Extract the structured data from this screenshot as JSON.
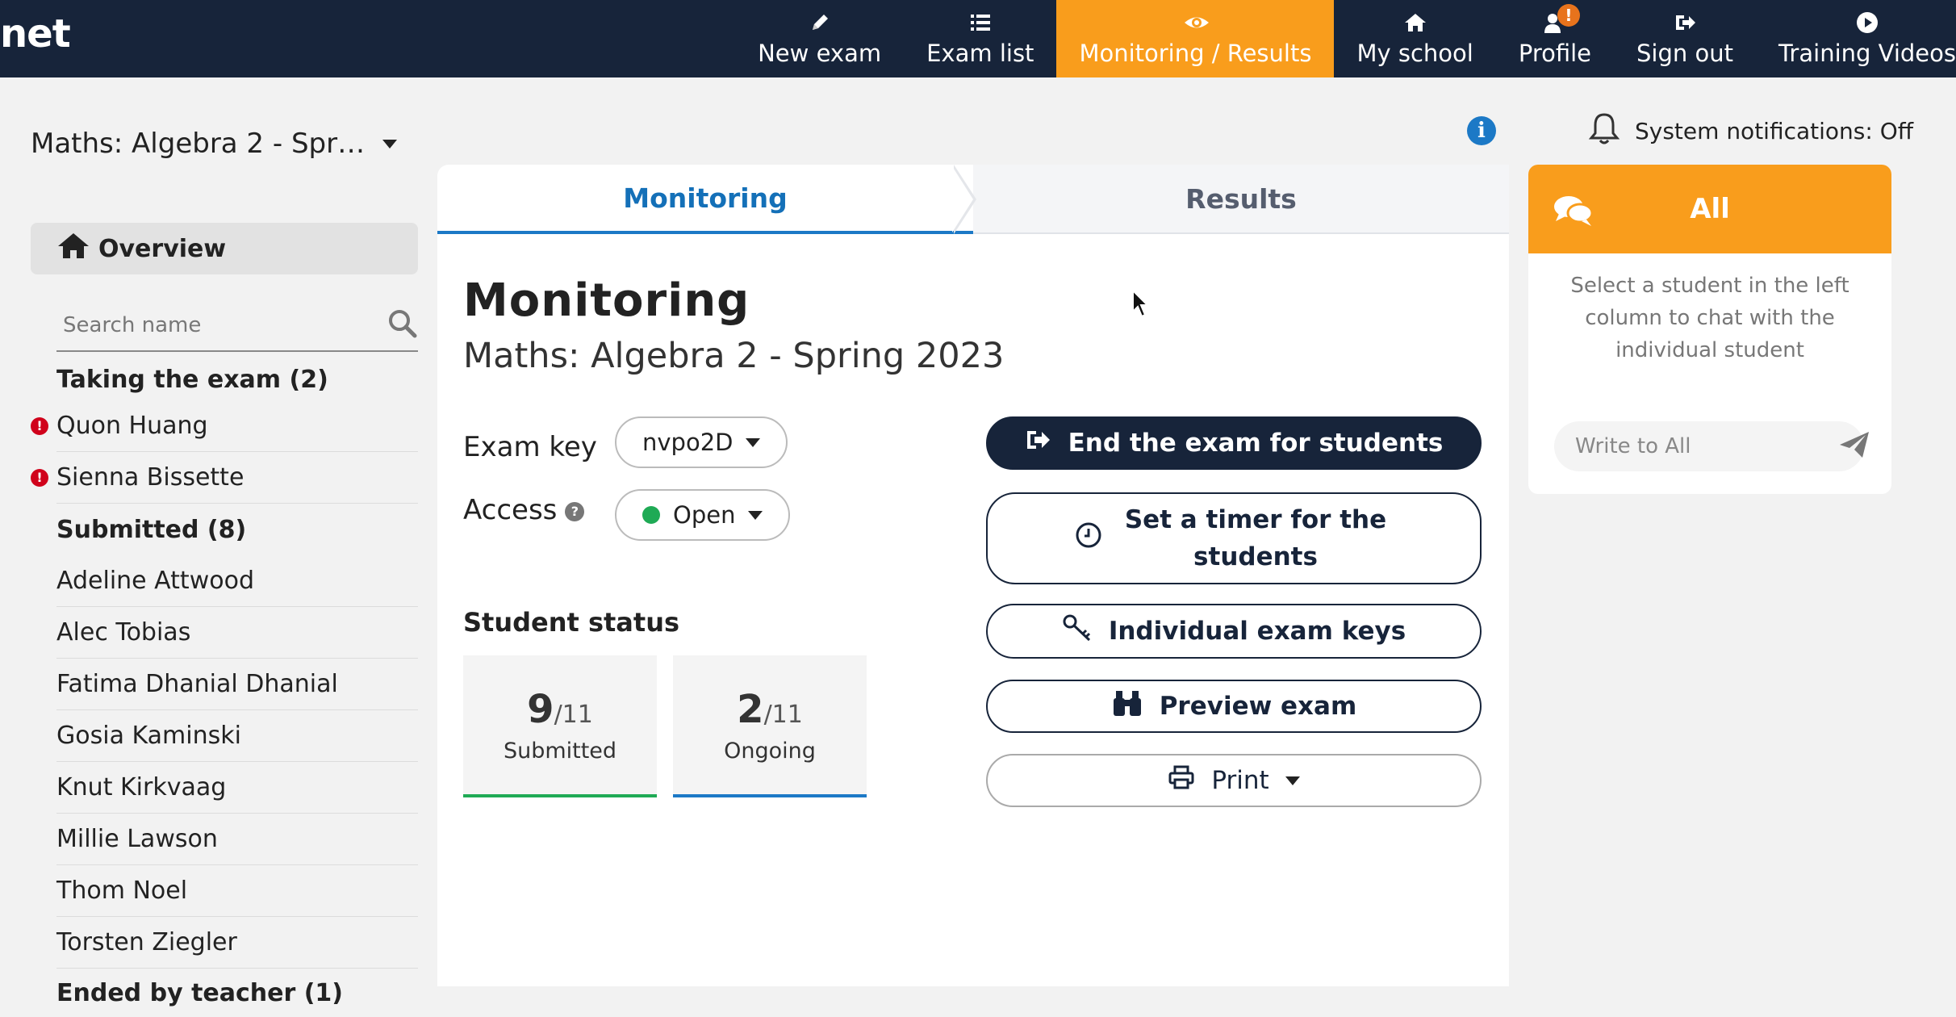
{
  "nav": {
    "brand": "net",
    "items": [
      {
        "label": "New exam",
        "icon": "pencil-icon"
      },
      {
        "label": "Exam list",
        "icon": "list-icon"
      },
      {
        "label": "Monitoring / Results",
        "icon": "eye-icon",
        "active": true
      },
      {
        "label": "My school",
        "icon": "home-icon"
      },
      {
        "label": "Profile",
        "icon": "users-icon",
        "badge": "!"
      },
      {
        "label": "Sign out",
        "icon": "sign-out-icon"
      },
      {
        "label": "Training Videos",
        "icon": "play-icon"
      }
    ]
  },
  "sidebar": {
    "exam_select": "Maths: Algebra 2 - Spr…",
    "overview_label": "Overview",
    "search_placeholder": "Search name",
    "groups": [
      {
        "title": "Taking the exam (2)",
        "students": [
          {
            "name": "Quon Huang",
            "warning": true
          },
          {
            "name": "Sienna Bissette",
            "warning": true
          }
        ]
      },
      {
        "title": "Submitted (8)",
        "students": [
          {
            "name": "Adeline Attwood"
          },
          {
            "name": "Alec Tobias"
          },
          {
            "name": "Fatima Dhanial Dhanial"
          },
          {
            "name": "Gosia Kaminski"
          },
          {
            "name": "Knut Kirkvaag"
          },
          {
            "name": "Millie Lawson"
          },
          {
            "name": "Thom Noel"
          },
          {
            "name": "Torsten Ziegler"
          }
        ]
      },
      {
        "title": "Ended by teacher (1)",
        "students": []
      }
    ]
  },
  "main": {
    "tabs": {
      "monitoring": "Monitoring",
      "results": "Results"
    },
    "title": "Monitoring",
    "subtitle": "Maths: Algebra 2 - Spring 2023",
    "exam_key_label": "Exam key",
    "exam_key_value": "nvpo2D",
    "access_label": "Access",
    "access_help": "?",
    "access_value": "Open",
    "student_status_title": "Student status",
    "stats": [
      {
        "value": "9",
        "total": "/11",
        "label": "Submitted",
        "color": "#1faa55"
      },
      {
        "value": "2",
        "total": "/11",
        "label": "Ongoing",
        "color": "#1c79c6"
      }
    ],
    "buttons": {
      "end_exam": "End the exam for students",
      "set_timer": "Set a timer for the students",
      "individual_keys": "Individual exam keys",
      "preview": "Preview exam",
      "print": "Print"
    }
  },
  "right": {
    "info": "i",
    "notifications": "System notifications: Off",
    "chat_title": "All",
    "chat_hint": "Select a student in the left column to chat with the individual student",
    "chat_placeholder": "Write to All"
  },
  "colors": {
    "nav_bg": "#17243a",
    "accent": "#f99d1c",
    "link_blue": "#1c79c6",
    "success": "#1faa55",
    "warning": "#d0021b"
  }
}
